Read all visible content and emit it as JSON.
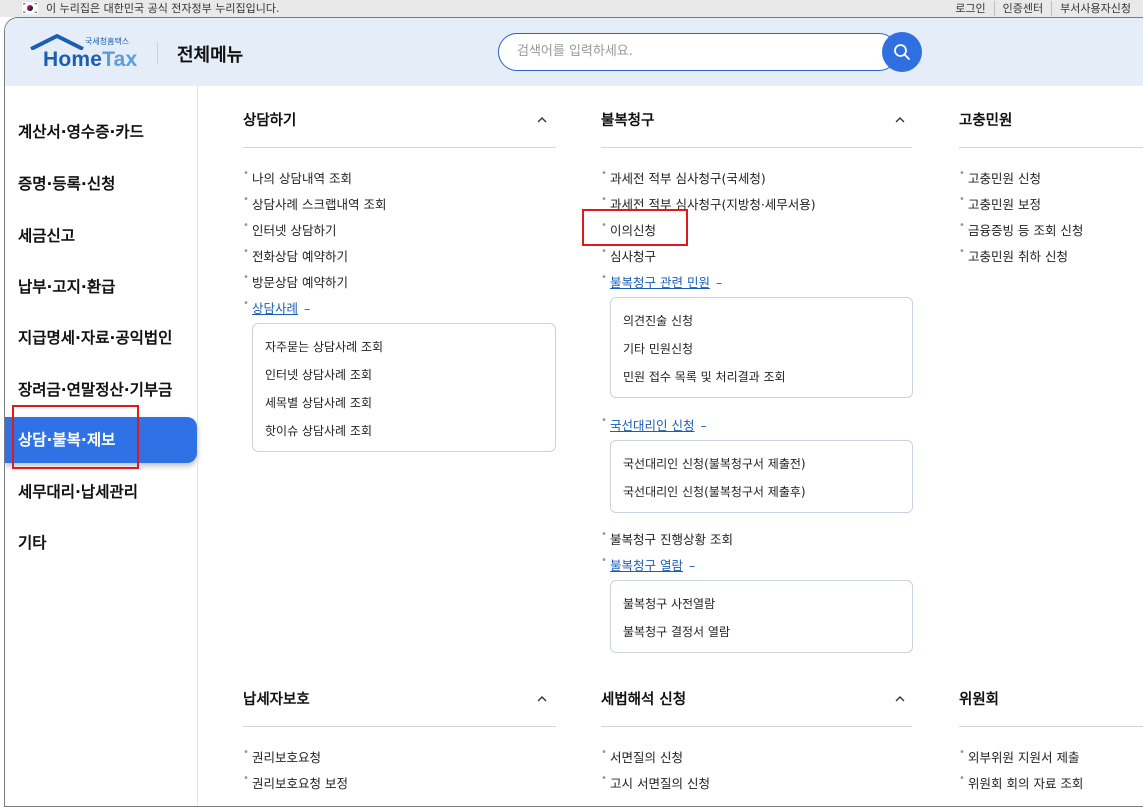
{
  "gov_bar": {
    "text": "이 누리집은 대한민국 공식 전자정부 누리집입니다.",
    "links": [
      "로그인",
      "인증센터",
      "부서사용자신청"
    ]
  },
  "header": {
    "logo_sub": "국세청홈택스",
    "logo_main_a": "Home",
    "logo_main_b": "Tax",
    "title": "전체메뉴",
    "search_placeholder": "검색어를 입력하세요."
  },
  "sidebar": {
    "items": [
      {
        "label": "계산서·영수증·카드"
      },
      {
        "label": "증명·등록·신청"
      },
      {
        "label": "세금신고"
      },
      {
        "label": "납부·고지·환급"
      },
      {
        "label": "지급명세·자료·공익법인"
      },
      {
        "label": "장려금·연말정산·기부금"
      },
      {
        "label": "상담·불복·제보"
      },
      {
        "label": "세무대리·납세관리"
      },
      {
        "label": "기타"
      }
    ],
    "active_index": 6
  },
  "sections": {
    "consult": {
      "title": "상담하기",
      "items": [
        "나의 상담내역 조회",
        "상담사례 스크랩내역 조회",
        "인터넷 상담하기",
        "전화상담 예약하기",
        "방문상담 예약하기"
      ],
      "expand_label": "상담사례",
      "expand_dash": "–",
      "sub": [
        "자주묻는 상담사례 조회",
        "인터넷 상담사례 조회",
        "세목별 상담사례 조회",
        "핫이슈 상담사례 조회"
      ]
    },
    "appeal": {
      "title": "불복청구",
      "items": [
        "과세전 적부 심사청구(국세청)",
        "과세전 적부 심사청구(지방청·세무서용)",
        "이의신청",
        "심사청구"
      ],
      "expand1_label": "불복청구 관련 민원",
      "expand1_dash": "–",
      "sub1": [
        "의견진술 신청",
        "기타 민원신청",
        "민원 접수 목록 및 처리결과 조회"
      ],
      "expand2_label": "국선대리인 신청",
      "expand2_dash": "–",
      "sub2": [
        "국선대리인 신청(불복청구서 제출전)",
        "국선대리인 신청(불복청구서 제출후)"
      ],
      "progress_item": "불복청구 진행상황 조회",
      "expand3_label": "불복청구 열람",
      "expand3_dash": "–",
      "sub3": [
        "불복청구 사전열람",
        "불복청구 결정서 열람"
      ]
    },
    "grievance": {
      "title": "고충민원",
      "items": [
        "고충민원 신청",
        "고충민원 보정",
        "금융증빙 등 조회 신청",
        "고충민원 취하 신청"
      ]
    },
    "protection": {
      "title": "납세자보호",
      "items": [
        "권리보호요청",
        "권리보호요청 보정"
      ]
    },
    "interpretation": {
      "title": "세법해석 신청",
      "items": [
        "서면질의 신청",
        "고시 서면질의 신청"
      ]
    },
    "committee": {
      "title": "위원회",
      "items": [
        "외부위원 지원서 제출",
        "위원회 회의 자료 조회"
      ]
    }
  },
  "colors": {
    "accent": "#2f72e6",
    "link": "#1a5fb4",
    "header_bg": "#e4edf8",
    "highlight_border": "#e01a1a"
  }
}
